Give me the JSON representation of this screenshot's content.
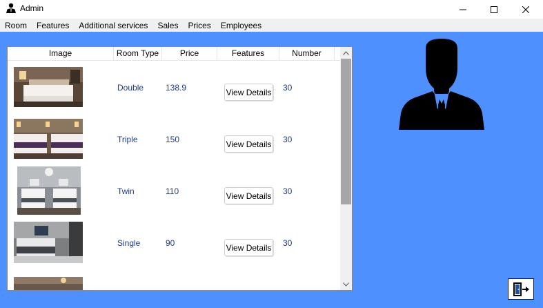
{
  "window": {
    "title": "Admin"
  },
  "menu": [
    {
      "label": "Room"
    },
    {
      "label": "Features"
    },
    {
      "label": "Additional services"
    },
    {
      "label": "Sales"
    },
    {
      "label": "Prices"
    },
    {
      "label": "Employees"
    }
  ],
  "grid": {
    "columns": [
      {
        "label": "Image"
      },
      {
        "label": "Room Type"
      },
      {
        "label": "Price"
      },
      {
        "label": "Features"
      },
      {
        "label": "Number"
      }
    ],
    "rows": [
      {
        "room_type": "Double",
        "price": "138.9",
        "features_button": "View Details",
        "number": "30"
      },
      {
        "room_type": "Triple",
        "price": "150",
        "features_button": "View Details",
        "number": "30"
      },
      {
        "room_type": "Twin",
        "price": "110",
        "features_button": "View Details",
        "number": "30"
      },
      {
        "room_type": "Single",
        "price": "90",
        "features_button": "View Details",
        "number": "30"
      },
      {
        "room_type": "",
        "price": "",
        "features_button": "",
        "number": ""
      }
    ]
  },
  "colors": {
    "background": "#4d90fe",
    "cell_text": "#1f3a8a",
    "scroll_thumb": "#a6a6a6"
  },
  "icons": {
    "app": "admin-person-icon",
    "avatar": "businessman-silhouette-icon",
    "logout": "exit-door-icon"
  }
}
